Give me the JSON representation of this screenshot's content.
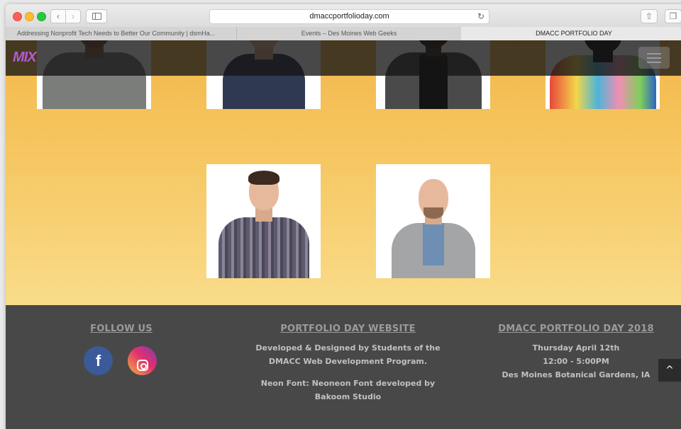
{
  "browser": {
    "url": "dmaccportfolioday.com",
    "tabs": [
      {
        "label": "Addressing Nonprofit Tech Needs to Better Our Community | dsmHa..."
      },
      {
        "label": "Events – Des Moines Web Geeks"
      },
      {
        "label": "DMACC PORTFOLIO DAY"
      }
    ]
  },
  "header": {
    "logo": "MIX"
  },
  "footer": {
    "follow": {
      "title": "FOLLOW US",
      "facebook_glyph": "f"
    },
    "website": {
      "title": "PORTFOLIO DAY WEBSITE",
      "line1": "Developed & Designed by Students of the",
      "line2": "DMACC Web Development Program.",
      "line3": "Neon Font: Neoneon Font developed by",
      "line4": "Bakoom Studio"
    },
    "event": {
      "title": "DMACC PORTFOLIO DAY 2018",
      "date": "Thursday April 12th",
      "time": "12:00 - 5:00PM",
      "location": "Des Moines Botanical Gardens, IA"
    },
    "back_to_top": "^"
  },
  "colors": {
    "hero_top": "#f3b84c",
    "hero_bottom": "#f9dc8a",
    "footer_bg": "#484848",
    "facebook": "#3b5a9a"
  }
}
